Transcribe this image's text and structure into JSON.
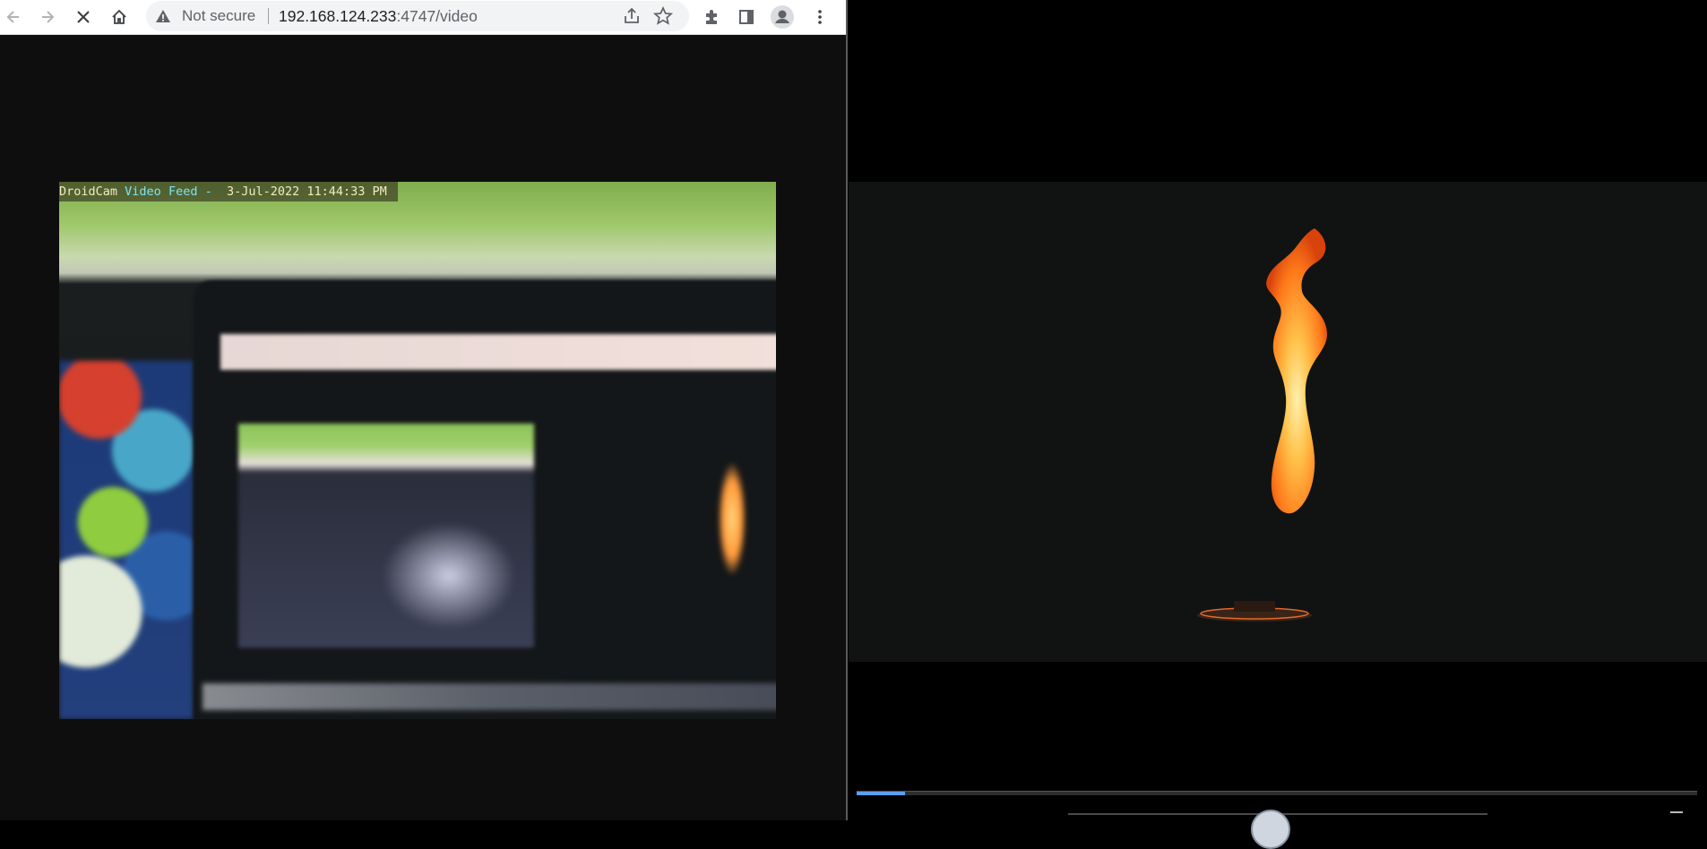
{
  "browser": {
    "omnibox": {
      "security_label": "Not secure",
      "url_host": "192.168.124.233",
      "url_rest": ":4747/video"
    },
    "icons": {
      "back": "arrow-left-icon",
      "forward": "arrow-right-icon",
      "stop": "close-icon",
      "home": "home-icon",
      "warning": "warning-icon",
      "share": "share-icon",
      "bookmark": "star-icon",
      "extensions": "puzzle-icon",
      "side_panel": "side-panel-icon",
      "profile": "profile-icon",
      "menu": "more-vert-icon"
    },
    "video_overlay": {
      "app_name": "DroidCam",
      "feed_label": "Video Feed -",
      "timestamp": "3-Jul-2022 11:44:33 PM"
    }
  },
  "player": {
    "progress_fraction": 0.058,
    "colors": {
      "progress": "#5e9ef0",
      "flame_core": "#ffd27a",
      "flame_outer": "#ff7a1a"
    }
  }
}
